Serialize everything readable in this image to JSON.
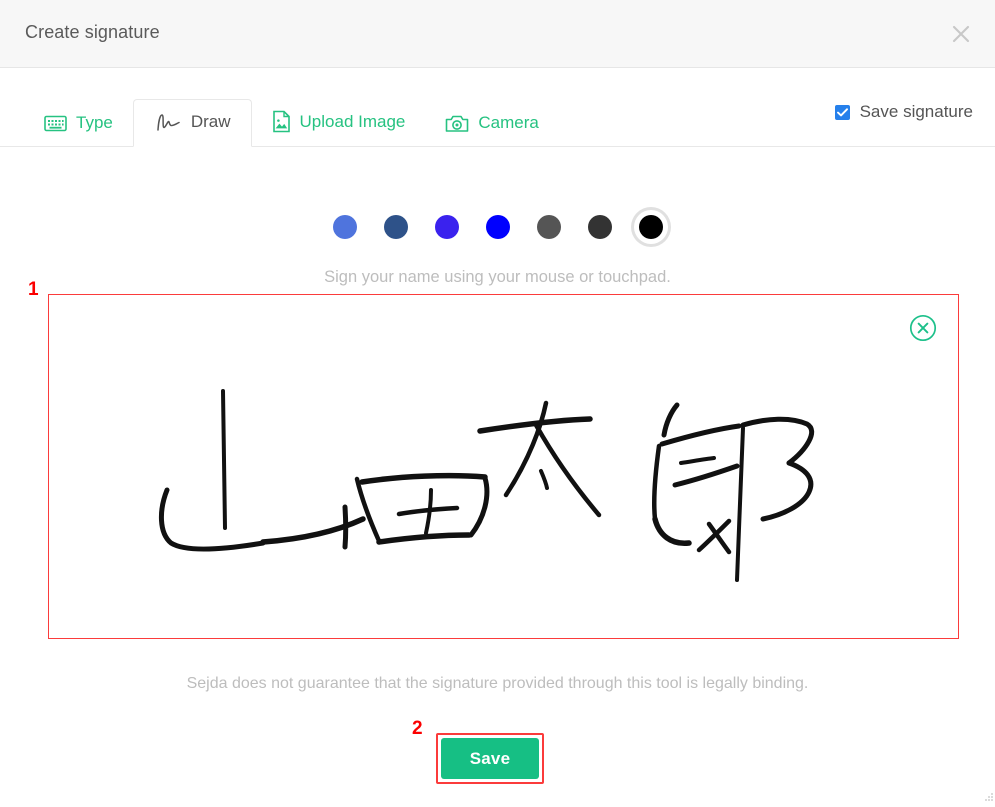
{
  "header": {
    "title": "Create signature",
    "close_icon": "close-icon"
  },
  "tabs": [
    {
      "label": "Type",
      "icon": "keyboard-icon",
      "active": false
    },
    {
      "label": "Draw",
      "icon": "signature-scribble-icon",
      "active": true
    },
    {
      "label": "Upload Image",
      "icon": "image-document-icon",
      "active": false
    },
    {
      "label": "Camera",
      "icon": "camera-icon",
      "active": false
    }
  ],
  "save_signature": {
    "label": "Save signature",
    "checked": true,
    "checkbox_color": "#2680eb"
  },
  "colors": {
    "selected_index": 6,
    "swatches": [
      {
        "name": "cornflower-blue",
        "hex": "#4f74dd"
      },
      {
        "name": "steel-blue",
        "hex": "#2e5289"
      },
      {
        "name": "violet-blue",
        "hex": "#3a22ee"
      },
      {
        "name": "pure-blue",
        "hex": "#0000fe"
      },
      {
        "name": "medium-grey",
        "hex": "#555555"
      },
      {
        "name": "dark-grey",
        "hex": "#333333"
      },
      {
        "name": "black",
        "hex": "#000000"
      }
    ]
  },
  "canvas": {
    "hint": "Sign your name using your mouse or touchpad.",
    "clear_icon": "clear-circle-x-icon",
    "clear_icon_color": "#1cc08a",
    "signature_text": "山田太郎",
    "border_color": "#fb3b3b"
  },
  "disclaimer": "Sejda does not guarantee that the signature provided through this tool is legally binding.",
  "footer": {
    "save_label": "Save",
    "save_color": "#16bf84",
    "highlight_color": "#fb3b3b"
  },
  "annotations": [
    {
      "label": "1",
      "target": "draw-canvas"
    },
    {
      "label": "2",
      "target": "save-button"
    }
  ]
}
